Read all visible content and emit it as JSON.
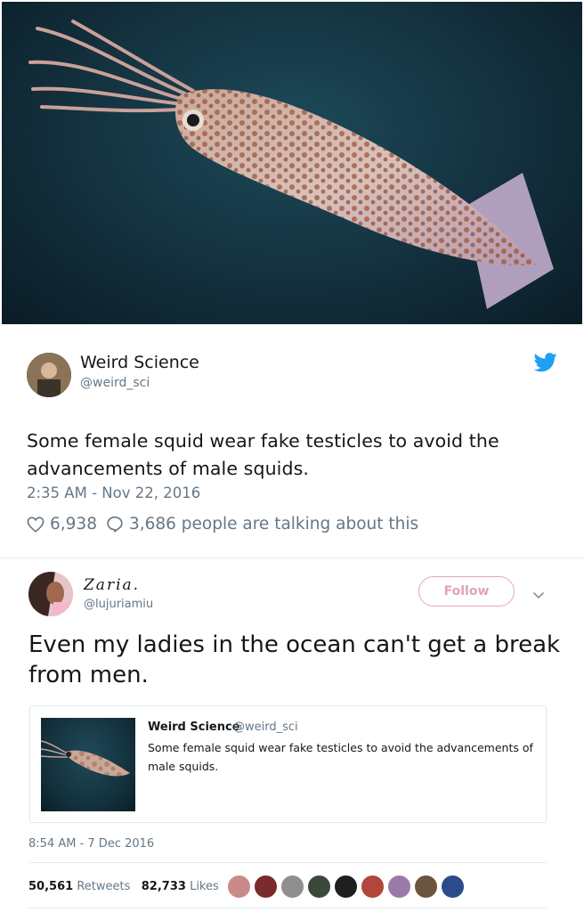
{
  "tweet1": {
    "name": "Weird Science",
    "handle": "@weird_sci",
    "text": "Some female squid wear fake testicles to avoid the advancements of male squids.",
    "timestamp": "2:35 AM - Nov 22, 2016",
    "likes": "6,938",
    "talking": "3,686 people are talking about this",
    "brand_color": "#1da1f2"
  },
  "tweet2": {
    "name": "Zaria.",
    "handle": "@lujuriamiu",
    "follow_label": "Follow",
    "text": "Even my ladies in the ocean can't get a break from men.",
    "timestamp": "8:54 AM - 7 Dec 2016",
    "retweets_count": "50,561",
    "retweets_label": "Retweets",
    "likes_count": "82,733",
    "likes_label": "Likes",
    "quote": {
      "name": "Weird Science",
      "handle": "@weird_sci",
      "text": "Some female squid wear fake testicles to avoid the advancements of male squids."
    },
    "liker_colors": [
      "#c98a8a",
      "#7a2a2a",
      "#8f8f8f",
      "#3a4a3a",
      "#1f1f1f",
      "#b4453a",
      "#9c7aa8",
      "#6b5540",
      "#2c4b8a"
    ]
  }
}
